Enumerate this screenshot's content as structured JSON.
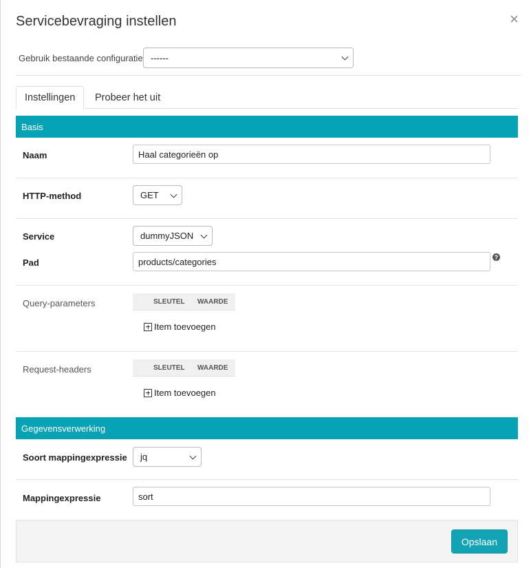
{
  "dialog": {
    "title": "Servicebevraging instellen",
    "close_symbol": "×"
  },
  "config": {
    "label": "Gebruik bestaande configuratie",
    "selected": "------"
  },
  "tabs": [
    {
      "label": "Instellingen",
      "active": true
    },
    {
      "label": "Probeer het uit",
      "active": false
    }
  ],
  "basis": {
    "section_title": "Basis",
    "naam_label": "Naam",
    "naam_value": "Haal categorieën op",
    "method_label": "HTTP-method",
    "method_value": "GET",
    "service_label": "Service",
    "service_value": "dummyJSON",
    "pad_label": "Pad",
    "pad_value": "products/categories",
    "help_symbol": "?",
    "query_label": "Query-parameters",
    "headers_label": "Request-headers",
    "col_key": "SLEUTEL",
    "col_value": "WAARDE",
    "add_item": "Item toevoegen"
  },
  "processing": {
    "section_title": "Gegevensverwerking",
    "type_label": "Soort mappingexpressie",
    "type_value": "jq",
    "expr_label": "Mappingexpressie",
    "expr_value": "sort"
  },
  "footer": {
    "save_label": "Opslaan"
  },
  "colors": {
    "accent": "#07a3b4"
  }
}
